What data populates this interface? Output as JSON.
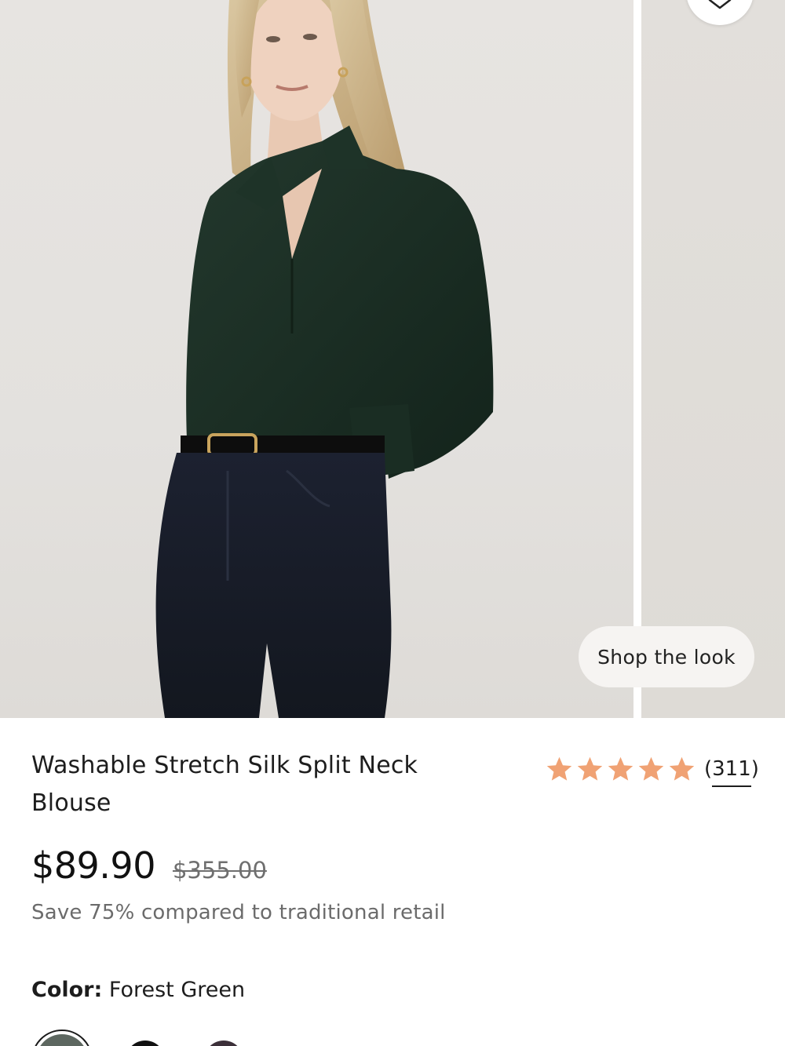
{
  "gallery": {
    "wishlist_icon": "heart-icon",
    "shop_the_look_label": "Shop the look"
  },
  "product": {
    "title": "Washable Stretch Silk Split Neck Blouse",
    "rating": {
      "stars": 5,
      "star_color": "#f0a274",
      "review_count_label": "(311)"
    },
    "price": {
      "current": "$89.90",
      "original": "$355.00"
    },
    "savings_text": "Save 75% compared to traditional retail",
    "color": {
      "label": "Color:",
      "value": "Forest Green",
      "swatches": [
        {
          "name": "Forest Green",
          "hex": "#5d6760",
          "selected": true
        },
        {
          "name": "Black",
          "hex": "#111111",
          "selected": false
        },
        {
          "name": "Plum",
          "hex": "#3c3039",
          "selected": false
        }
      ]
    }
  }
}
